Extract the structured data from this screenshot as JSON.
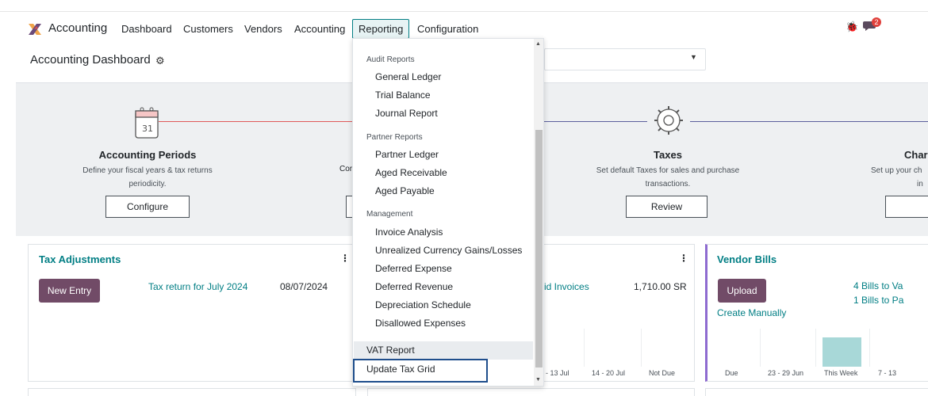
{
  "topnav": {
    "app_title": "Accounting",
    "items": [
      "Dashboard",
      "Customers",
      "Vendors",
      "Accounting",
      "Reporting",
      "Configuration"
    ],
    "notification_count": "2"
  },
  "control": {
    "page_title": "Accounting Dashboard"
  },
  "onboarding": {
    "steps": [
      {
        "title": "Accounting Periods",
        "desc_line1": "Define your fiscal years & tax returns",
        "desc_line2": "periodicity.",
        "button": "Configure"
      },
      {
        "title": "Taxes",
        "desc_line1": "Set default Taxes for sales and purchase",
        "desc_line2": "transactions.",
        "button": "Review"
      },
      {
        "title": "Char",
        "desc_line1": "Set up your ch",
        "desc_line2": "in",
        "button": ""
      }
    ],
    "partial_left_text": "Cor"
  },
  "cards": {
    "tax": {
      "title": "Tax Adjustments",
      "button": "New Entry",
      "entry_link": "Tax return for July 2024",
      "entry_date": "08/07/2024"
    },
    "middle": {
      "link": "id Invoices",
      "amount": "1,710.00 SR",
      "axis": [
        "- 13 Jul",
        "14 - 20 Jul",
        "Not Due"
      ]
    },
    "vendor": {
      "title": "Vendor Bills",
      "button": "Upload",
      "create_link": "Create Manually",
      "link1": "4 Bills to Va",
      "link2": "1 Bills to Pa",
      "axis": [
        "Due",
        "23 - 29 Jun",
        "This Week",
        "7 - 13"
      ]
    }
  },
  "reporting_menu": {
    "sections": [
      {
        "header": "Audit Reports",
        "items": [
          "General Ledger",
          "Trial Balance",
          "Journal Report"
        ]
      },
      {
        "header": "Partner Reports",
        "items": [
          "Partner Ledger",
          "Aged Receivable",
          "Aged Payable"
        ]
      },
      {
        "header": "Management",
        "items": [
          "Invoice Analysis",
          "Unrealized Currency Gains/Losses",
          "Deferred Expense",
          "Deferred Revenue",
          "Depreciation Schedule",
          "Disallowed Expenses"
        ]
      }
    ],
    "flat_items": [
      "VAT Report",
      "Update Tax Grid"
    ]
  },
  "colors": {
    "accent": "#017e84",
    "primary": "#714b67",
    "focus": "#1f4e8c",
    "bar": "#a8d8d8"
  }
}
